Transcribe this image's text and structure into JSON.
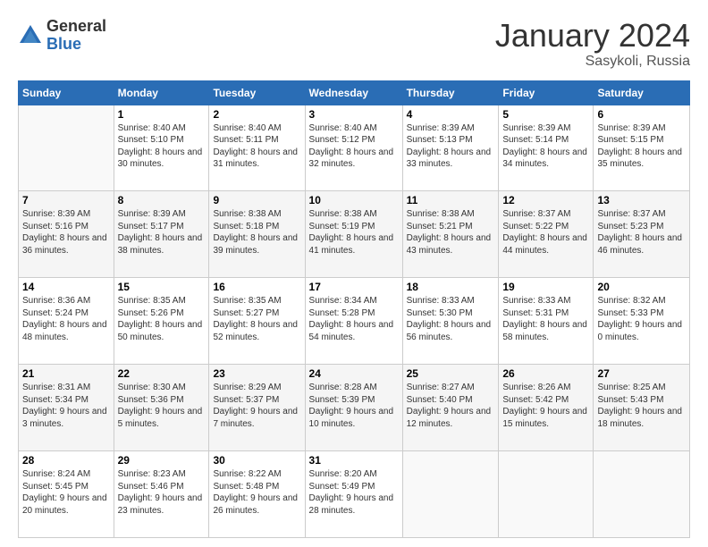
{
  "header": {
    "logo_general": "General",
    "logo_blue": "Blue",
    "month_title": "January 2024",
    "location": "Sasykoli, Russia"
  },
  "days_of_week": [
    "Sunday",
    "Monday",
    "Tuesday",
    "Wednesday",
    "Thursday",
    "Friday",
    "Saturday"
  ],
  "weeks": [
    {
      "days": [
        {
          "date": "",
          "sunrise": "",
          "sunset": "",
          "daylight": ""
        },
        {
          "date": "1",
          "sunrise": "8:40 AM",
          "sunset": "5:10 PM",
          "daylight": "8 hours and 30 minutes."
        },
        {
          "date": "2",
          "sunrise": "8:40 AM",
          "sunset": "5:11 PM",
          "daylight": "8 hours and 31 minutes."
        },
        {
          "date": "3",
          "sunrise": "8:40 AM",
          "sunset": "5:12 PM",
          "daylight": "8 hours and 32 minutes."
        },
        {
          "date": "4",
          "sunrise": "8:39 AM",
          "sunset": "5:13 PM",
          "daylight": "8 hours and 33 minutes."
        },
        {
          "date": "5",
          "sunrise": "8:39 AM",
          "sunset": "5:14 PM",
          "daylight": "8 hours and 34 minutes."
        },
        {
          "date": "6",
          "sunrise": "8:39 AM",
          "sunset": "5:15 PM",
          "daylight": "8 hours and 35 minutes."
        }
      ]
    },
    {
      "days": [
        {
          "date": "7",
          "sunrise": "8:39 AM",
          "sunset": "5:16 PM",
          "daylight": "8 hours and 36 minutes."
        },
        {
          "date": "8",
          "sunrise": "8:39 AM",
          "sunset": "5:17 PM",
          "daylight": "8 hours and 38 minutes."
        },
        {
          "date": "9",
          "sunrise": "8:38 AM",
          "sunset": "5:18 PM",
          "daylight": "8 hours and 39 minutes."
        },
        {
          "date": "10",
          "sunrise": "8:38 AM",
          "sunset": "5:19 PM",
          "daylight": "8 hours and 41 minutes."
        },
        {
          "date": "11",
          "sunrise": "8:38 AM",
          "sunset": "5:21 PM",
          "daylight": "8 hours and 43 minutes."
        },
        {
          "date": "12",
          "sunrise": "8:37 AM",
          "sunset": "5:22 PM",
          "daylight": "8 hours and 44 minutes."
        },
        {
          "date": "13",
          "sunrise": "8:37 AM",
          "sunset": "5:23 PM",
          "daylight": "8 hours and 46 minutes."
        }
      ]
    },
    {
      "days": [
        {
          "date": "14",
          "sunrise": "8:36 AM",
          "sunset": "5:24 PM",
          "daylight": "8 hours and 48 minutes."
        },
        {
          "date": "15",
          "sunrise": "8:35 AM",
          "sunset": "5:26 PM",
          "daylight": "8 hours and 50 minutes."
        },
        {
          "date": "16",
          "sunrise": "8:35 AM",
          "sunset": "5:27 PM",
          "daylight": "8 hours and 52 minutes."
        },
        {
          "date": "17",
          "sunrise": "8:34 AM",
          "sunset": "5:28 PM",
          "daylight": "8 hours and 54 minutes."
        },
        {
          "date": "18",
          "sunrise": "8:33 AM",
          "sunset": "5:30 PM",
          "daylight": "8 hours and 56 minutes."
        },
        {
          "date": "19",
          "sunrise": "8:33 AM",
          "sunset": "5:31 PM",
          "daylight": "8 hours and 58 minutes."
        },
        {
          "date": "20",
          "sunrise": "8:32 AM",
          "sunset": "5:33 PM",
          "daylight": "9 hours and 0 minutes."
        }
      ]
    },
    {
      "days": [
        {
          "date": "21",
          "sunrise": "8:31 AM",
          "sunset": "5:34 PM",
          "daylight": "9 hours and 3 minutes."
        },
        {
          "date": "22",
          "sunrise": "8:30 AM",
          "sunset": "5:36 PM",
          "daylight": "9 hours and 5 minutes."
        },
        {
          "date": "23",
          "sunrise": "8:29 AM",
          "sunset": "5:37 PM",
          "daylight": "9 hours and 7 minutes."
        },
        {
          "date": "24",
          "sunrise": "8:28 AM",
          "sunset": "5:39 PM",
          "daylight": "9 hours and 10 minutes."
        },
        {
          "date": "25",
          "sunrise": "8:27 AM",
          "sunset": "5:40 PM",
          "daylight": "9 hours and 12 minutes."
        },
        {
          "date": "26",
          "sunrise": "8:26 AM",
          "sunset": "5:42 PM",
          "daylight": "9 hours and 15 minutes."
        },
        {
          "date": "27",
          "sunrise": "8:25 AM",
          "sunset": "5:43 PM",
          "daylight": "9 hours and 18 minutes."
        }
      ]
    },
    {
      "days": [
        {
          "date": "28",
          "sunrise": "8:24 AM",
          "sunset": "5:45 PM",
          "daylight": "9 hours and 20 minutes."
        },
        {
          "date": "29",
          "sunrise": "8:23 AM",
          "sunset": "5:46 PM",
          "daylight": "9 hours and 23 minutes."
        },
        {
          "date": "30",
          "sunrise": "8:22 AM",
          "sunset": "5:48 PM",
          "daylight": "9 hours and 26 minutes."
        },
        {
          "date": "31",
          "sunrise": "8:20 AM",
          "sunset": "5:49 PM",
          "daylight": "9 hours and 28 minutes."
        },
        {
          "date": "",
          "sunrise": "",
          "sunset": "",
          "daylight": ""
        },
        {
          "date": "",
          "sunrise": "",
          "sunset": "",
          "daylight": ""
        },
        {
          "date": "",
          "sunrise": "",
          "sunset": "",
          "daylight": ""
        }
      ]
    }
  ],
  "labels": {
    "sunrise_prefix": "Sunrise: ",
    "sunset_prefix": "Sunset: ",
    "daylight_prefix": "Daylight: "
  }
}
